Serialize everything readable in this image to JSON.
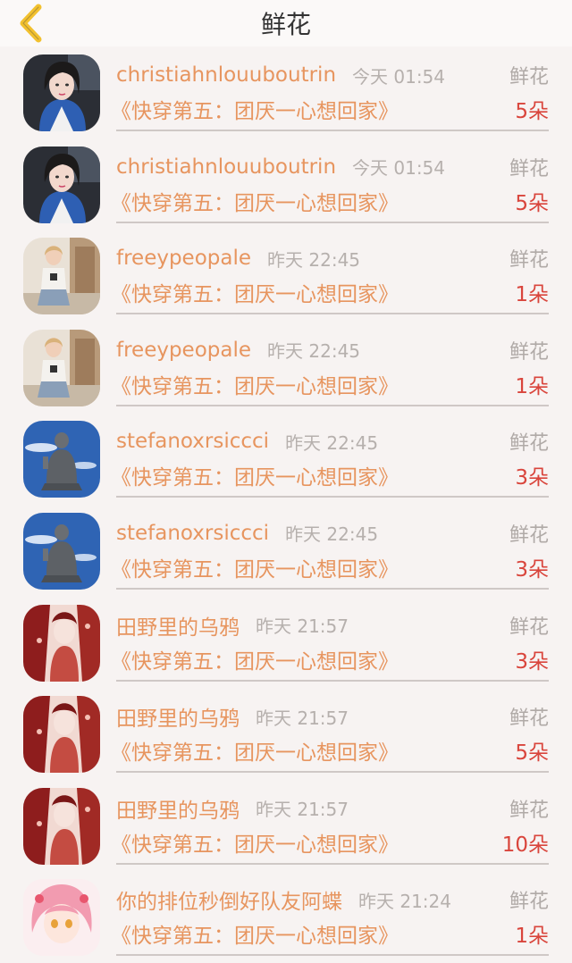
{
  "header": {
    "title": "鲜花",
    "back_icon": "chevron-left-icon",
    "accent": "#f2c12e"
  },
  "colors": {
    "name": "#e7955f",
    "time": "#b6b0ad",
    "count": "#d9453c"
  },
  "records": [
    {
      "avatar": "woman-dark-hair",
      "name": "christiahnlouuboutrin",
      "time": "今天 01:54",
      "gift": "鲜花",
      "book": "《快穿第五：团厌一心想回家》",
      "count": "5朵"
    },
    {
      "avatar": "woman-dark-hair",
      "name": "christiahnlouuboutrin",
      "time": "今天 01:54",
      "gift": "鲜花",
      "book": "《快穿第五：团厌一心想回家》",
      "count": "5朵"
    },
    {
      "avatar": "woman-seated",
      "name": "freeypeopale",
      "time": "昨天 22:45",
      "gift": "鲜花",
      "book": "《快穿第五：团厌一心想回家》",
      "count": "1朵"
    },
    {
      "avatar": "woman-seated",
      "name": "freeypeopale",
      "time": "昨天 22:45",
      "gift": "鲜花",
      "book": "《快穿第五：团厌一心想回家》",
      "count": "1朵"
    },
    {
      "avatar": "buddha-statue",
      "name": "stefanoxrsiccci",
      "time": "昨天 22:45",
      "gift": "鲜花",
      "book": "《快穿第五：团厌一心想回家》",
      "count": "3朵"
    },
    {
      "avatar": "buddha-statue",
      "name": "stefanoxrsiccci",
      "time": "昨天 22:45",
      "gift": "鲜花",
      "book": "《快穿第五：团厌一心想回家》",
      "count": "3朵"
    },
    {
      "avatar": "red-illustration",
      "name": "田野里的乌鸦",
      "time": "昨天 21:57",
      "gift": "鲜花",
      "book": "《快穿第五：团厌一心想回家》",
      "count": "3朵"
    },
    {
      "avatar": "red-illustration",
      "name": "田野里的乌鸦",
      "time": "昨天 21:57",
      "gift": "鲜花",
      "book": "《快穿第五：团厌一心想回家》",
      "count": "5朵"
    },
    {
      "avatar": "red-illustration",
      "name": "田野里的乌鸦",
      "time": "昨天 21:57",
      "gift": "鲜花",
      "book": "《快穿第五：团厌一心想回家》",
      "count": "10朵"
    },
    {
      "avatar": "pink-anime-girl",
      "name": "你的排位秒倒好队友阿蝶",
      "time": "昨天 21:24",
      "gift": "鲜花",
      "book": "《快穿第五：团厌一心想回家》",
      "count": "1朵"
    }
  ]
}
